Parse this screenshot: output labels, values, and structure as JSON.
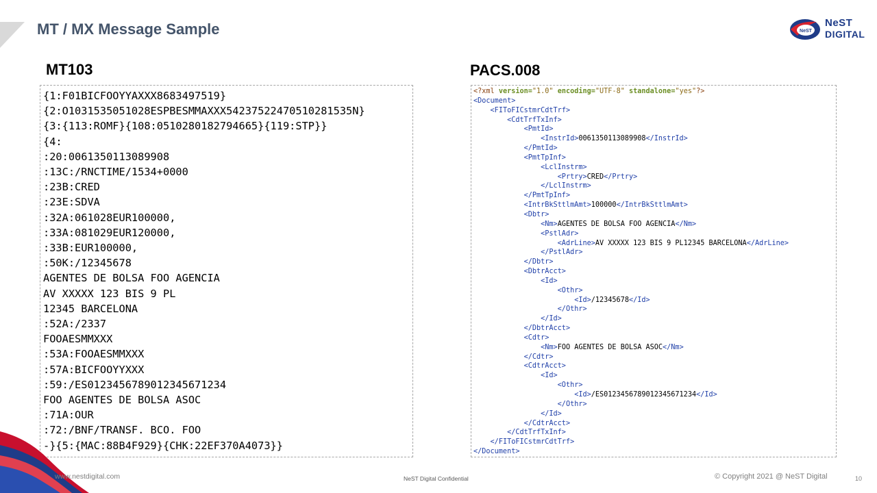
{
  "slide": {
    "title": "MT / MX Message Sample",
    "logo": {
      "line1": "NeST",
      "line2": "DIGITAL",
      "emblem_text": "NeST"
    },
    "mt": {
      "heading": "MT103",
      "lines": [
        "{1:F01BICFOOYYAXXX8683497519}",
        "{2:O1031535051028ESPBESMMAXXX54237522470510281535N}",
        "{3:{113:ROMF}{108:0510280182794665}{119:STP}}",
        "{4:",
        ":20:0061350113089908",
        ":13C:/RNCTIME/1534+0000",
        ":23B:CRED",
        ":23E:SDVA",
        ":32A:061028EUR100000,",
        ":33A:081029EUR120000,",
        ":33B:EUR100000,",
        ":50K:/12345678",
        "AGENTES DE BOLSA FOO AGENCIA",
        "AV XXXXX 123 BIS 9 PL",
        "12345 BARCELONA",
        ":52A:/2337",
        "FOOAESMMXXX",
        ":53A:FOOAESMMXXX",
        ":57A:BICFOOYYXXX",
        ":59:/ES0123456789012345671234",
        "FOO AGENTES DE BOLSA ASOC",
        ":71A:OUR",
        ":72:/BNF/TRANSF. BCO. FOO",
        "-}{5:{MAC:88B4F929}{CHK:22EF370A4073}}"
      ]
    },
    "pacs": {
      "heading": "PACS.008",
      "xml_decl": {
        "open": "<?xml",
        "version_attr": "version=",
        "version_val": "\"1.0\"",
        "encoding_attr": "encoding=",
        "encoding_val": "\"UTF-8\"",
        "standalone_attr": "standalone=",
        "standalone_val": "\"yes\"",
        "close": "?>"
      },
      "lines": [
        {
          "indent": 0,
          "open": "<Document>",
          "text": "",
          "close": ""
        },
        {
          "indent": 1,
          "open": "<FIToFICstmrCdtTrf>",
          "text": "",
          "close": ""
        },
        {
          "indent": 2,
          "open": "<CdtTrfTxInf>",
          "text": "",
          "close": ""
        },
        {
          "indent": 3,
          "open": "<PmtId>",
          "text": "",
          "close": ""
        },
        {
          "indent": 4,
          "open": "<InstrId>",
          "text": "0061350113089908",
          "close": "</InstrId>"
        },
        {
          "indent": 3,
          "open": "</PmtId>",
          "text": "",
          "close": ""
        },
        {
          "indent": 3,
          "open": "<PmtTpInf>",
          "text": "",
          "close": ""
        },
        {
          "indent": 4,
          "open": "<LclInstrm>",
          "text": "",
          "close": ""
        },
        {
          "indent": 5,
          "open": "<Prtry>",
          "text": "CRED",
          "close": "</Prtry>"
        },
        {
          "indent": 4,
          "open": "</LclInstrm>",
          "text": "",
          "close": ""
        },
        {
          "indent": 3,
          "open": "</PmtTpInf>",
          "text": "",
          "close": ""
        },
        {
          "indent": 3,
          "open": "<IntrBkSttlmAmt>",
          "text": "100000",
          "close": "</IntrBkSttlmAmt>"
        },
        {
          "indent": 3,
          "open": "<Dbtr>",
          "text": "",
          "close": ""
        },
        {
          "indent": 4,
          "open": "<Nm>",
          "text": "AGENTES DE BOLSA FOO AGENCIA",
          "close": "</Nm>"
        },
        {
          "indent": 4,
          "open": "<PstlAdr>",
          "text": "",
          "close": ""
        },
        {
          "indent": 5,
          "open": "<AdrLine>",
          "text": "AV XXXXX 123 BIS 9 PL12345 BARCELONA",
          "close": "</AdrLine>"
        },
        {
          "indent": 4,
          "open": "</PstlAdr>",
          "text": "",
          "close": ""
        },
        {
          "indent": 3,
          "open": "</Dbtr>",
          "text": "",
          "close": ""
        },
        {
          "indent": 3,
          "open": "<DbtrAcct>",
          "text": "",
          "close": ""
        },
        {
          "indent": 4,
          "open": "<Id>",
          "text": "",
          "close": ""
        },
        {
          "indent": 5,
          "open": "<Othr>",
          "text": "",
          "close": ""
        },
        {
          "indent": 6,
          "open": "<Id>",
          "text": "/12345678",
          "close": "</Id>"
        },
        {
          "indent": 5,
          "open": "</Othr>",
          "text": "",
          "close": ""
        },
        {
          "indent": 4,
          "open": "</Id>",
          "text": "",
          "close": ""
        },
        {
          "indent": 3,
          "open": "</DbtrAcct>",
          "text": "",
          "close": ""
        },
        {
          "indent": 3,
          "open": "<Cdtr>",
          "text": "",
          "close": ""
        },
        {
          "indent": 4,
          "open": "<Nm>",
          "text": "FOO AGENTES DE BOLSA ASOC",
          "close": "</Nm>"
        },
        {
          "indent": 3,
          "open": "</Cdtr>",
          "text": "",
          "close": ""
        },
        {
          "indent": 3,
          "open": "<CdtrAcct>",
          "text": "",
          "close": ""
        },
        {
          "indent": 4,
          "open": "<Id>",
          "text": "",
          "close": ""
        },
        {
          "indent": 5,
          "open": "<Othr>",
          "text": "",
          "close": ""
        },
        {
          "indent": 6,
          "open": "<Id>",
          "text": "/ES0123456789012345671234",
          "close": "</Id>"
        },
        {
          "indent": 5,
          "open": "</Othr>",
          "text": "",
          "close": ""
        },
        {
          "indent": 4,
          "open": "</Id>",
          "text": "",
          "close": ""
        },
        {
          "indent": 3,
          "open": "</CdtrAcct>",
          "text": "",
          "close": ""
        },
        {
          "indent": 2,
          "open": "</CdtTrfTxInf>",
          "text": "",
          "close": ""
        },
        {
          "indent": 1,
          "open": "</FIToFICstmrCdtTrf>",
          "text": "",
          "close": ""
        },
        {
          "indent": 0,
          "open": "</Document>",
          "text": "",
          "close": ""
        }
      ]
    },
    "footer": {
      "url": "www.nestdigital.com",
      "confidential": "NeST Digital Confidential",
      "copyright": "© Copyright 2021 @ NeST Digital",
      "page_number": "10"
    },
    "colors": {
      "title": "#44546a",
      "xml_tag": "#1f3fa8",
      "xml_attr": "#6b8e23",
      "xml_string": "#8b6914",
      "logo_blue": "#1f3c88",
      "logo_red": "#d9232e"
    }
  }
}
